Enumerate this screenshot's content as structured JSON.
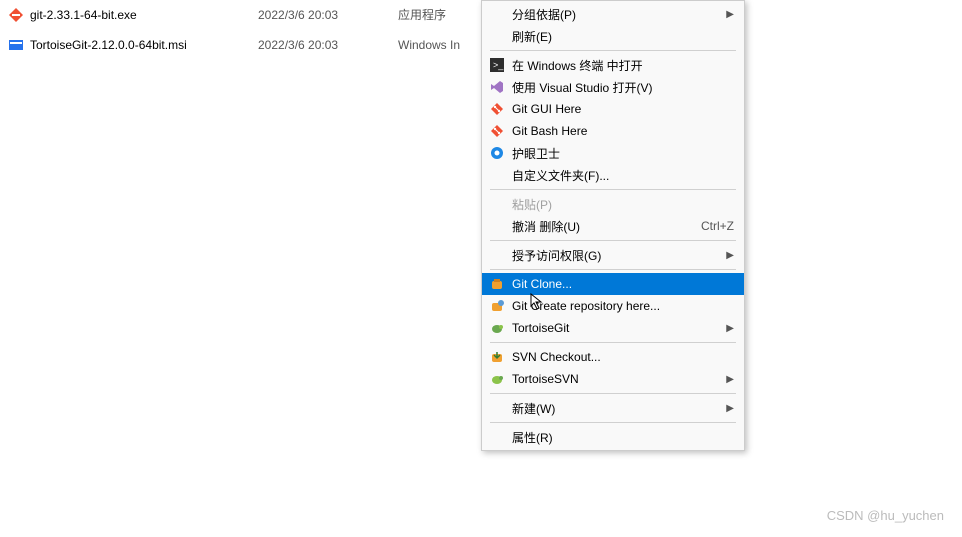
{
  "files": [
    {
      "name": "git-2.33.1-64-bit.exe",
      "date": "2022/3/6 20:03",
      "type": "应用程序",
      "icon": "git"
    },
    {
      "name": "TortoiseGit-2.12.0.0-64bit.msi",
      "date": "2022/3/6 20:03",
      "type": "Windows In",
      "icon": "msi"
    }
  ],
  "menu": {
    "items": [
      {
        "label": "分组依据(P)",
        "icon": "",
        "submenu": true
      },
      {
        "label": "刷新(E)",
        "icon": ""
      },
      {
        "sep": true
      },
      {
        "label": "在 Windows 终端 中打开",
        "icon": "terminal"
      },
      {
        "label": "使用 Visual Studio 打开(V)",
        "icon": "vs"
      },
      {
        "label": "Git GUI Here",
        "icon": "git"
      },
      {
        "label": "Git Bash Here",
        "icon": "git"
      },
      {
        "label": "护眼卫士",
        "icon": "eye"
      },
      {
        "label": "自定义文件夹(F)...",
        "icon": ""
      },
      {
        "sep": true
      },
      {
        "label": "粘贴(P)",
        "icon": "",
        "disabled": true
      },
      {
        "label": "撤消 删除(U)",
        "icon": "",
        "shortcut": "Ctrl+Z"
      },
      {
        "sep": true
      },
      {
        "label": "授予访问权限(G)",
        "icon": "",
        "submenu": true
      },
      {
        "sep": true
      },
      {
        "label": "Git Clone...",
        "icon": "tortoise-clone",
        "highlighted": true
      },
      {
        "label": "Git Create repository here...",
        "icon": "tortoise-create"
      },
      {
        "label": "TortoiseGit",
        "icon": "tortoise",
        "submenu": true
      },
      {
        "sep": true
      },
      {
        "label": "SVN Checkout...",
        "icon": "svn-checkout"
      },
      {
        "label": "TortoiseSVN",
        "icon": "svn",
        "submenu": true
      },
      {
        "sep": true
      },
      {
        "label": "新建(W)",
        "icon": "",
        "submenu": true
      },
      {
        "sep": true
      },
      {
        "label": "属性(R)",
        "icon": ""
      }
    ]
  },
  "watermark": "CSDN @hu_yuchen"
}
